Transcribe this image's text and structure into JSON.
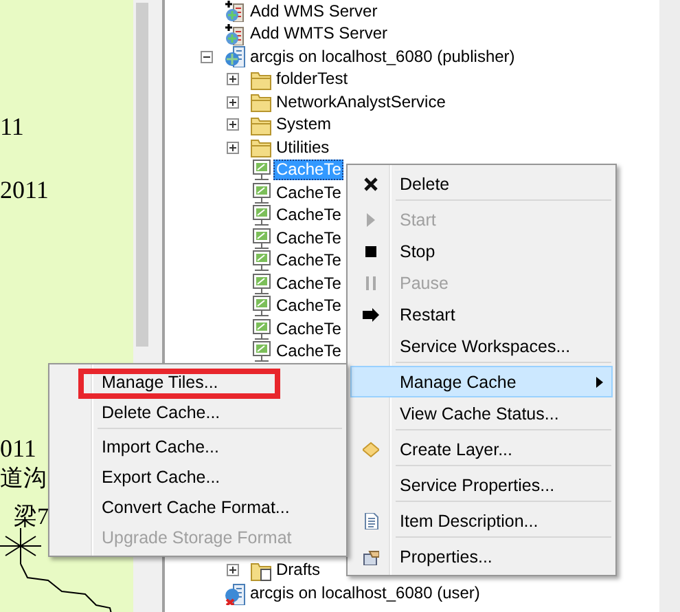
{
  "map": {
    "labels": [
      {
        "text": "11"
      },
      {
        "text": "2011"
      },
      {
        "text": "011"
      },
      {
        "text": "道沟"
      },
      {
        "text": "梁7"
      }
    ]
  },
  "tree": {
    "top": [
      {
        "children": [
          {
            "label": "Add WMS Server",
            "kind": "add"
          },
          {
            "label": "Add WMTS Server",
            "kind": "add"
          },
          {
            "label": "arcgis on localhost_6080 (publisher)",
            "kind": "server",
            "expanded": true,
            "children": [
              {
                "label": "folderTest",
                "kind": "folder",
                "expanded": false
              },
              {
                "label": "NetworkAnalystService",
                "kind": "folder",
                "expanded": false
              },
              {
                "label": "System",
                "kind": "folder",
                "expanded": false
              },
              {
                "label": "Utilities",
                "kind": "folder",
                "expanded": false
              },
              {
                "label": "CacheTe",
                "kind": "service",
                "selected": true
              },
              {
                "label": "CacheTe",
                "kind": "service",
                "selected": false
              },
              {
                "label": "CacheTe",
                "kind": "service",
                "selected": false
              },
              {
                "label": "CacheTe",
                "kind": "service",
                "selected": false
              },
              {
                "label": "CacheTe",
                "kind": "service",
                "selected": false
              },
              {
                "label": "CacheTe",
                "kind": "service",
                "selected": false
              },
              {
                "label": "CacheTe",
                "kind": "service",
                "selected": false
              },
              {
                "label": "CacheTe",
                "kind": "service",
                "selected": false
              },
              {
                "label": "CacheTe",
                "kind": "service",
                "selected": false
              }
            ]
          }
        ]
      }
    ],
    "bottom": [
      {
        "children": [
          {
            "children": [
              {
                "label": "Drafts",
                "kind": "drafts",
                "expanded": false
              }
            ]
          },
          {
            "label": "arcgis on localhost_6080 (user)",
            "kind": "offline"
          }
        ]
      }
    ]
  },
  "context_menu": {
    "items": [
      {
        "label": "Delete",
        "kind": "delete",
        "disabled": false,
        "separator_after": true,
        "highlighted": false
      },
      {
        "label": "Start",
        "kind": "start",
        "disabled": true,
        "separator_after": false,
        "highlighted": false
      },
      {
        "label": "Stop",
        "kind": "stop",
        "disabled": false,
        "separator_after": false,
        "highlighted": false
      },
      {
        "label": "Pause",
        "kind": "pause",
        "disabled": true,
        "separator_after": false,
        "highlighted": false
      },
      {
        "label": "Restart",
        "kind": "restart",
        "disabled": false,
        "separator_after": false,
        "highlighted": false
      },
      {
        "label": "Service Workspaces...",
        "kind": "plain",
        "disabled": false,
        "separator_after": true,
        "highlighted": false
      },
      {
        "label": "Manage Cache",
        "kind": "submenu",
        "disabled": false,
        "separator_after": false,
        "highlighted": true
      },
      {
        "label": "View Cache Status...",
        "kind": "plain",
        "disabled": false,
        "separator_after": true,
        "highlighted": false
      },
      {
        "label": "Create Layer...",
        "kind": "layer",
        "disabled": false,
        "separator_after": true,
        "highlighted": false
      },
      {
        "label": "Service Properties...",
        "kind": "plain",
        "disabled": false,
        "separator_after": true,
        "highlighted": false
      },
      {
        "label": "Item Description...",
        "kind": "description",
        "disabled": false,
        "separator_after": true,
        "highlighted": false
      },
      {
        "label": "Properties...",
        "kind": "properties",
        "disabled": false,
        "separator_after": false,
        "highlighted": false
      }
    ]
  },
  "submenu": {
    "items": [
      {
        "label": "Manage Tiles...",
        "disabled": false,
        "separator_after": false,
        "annotated": true
      },
      {
        "label": "Delete Cache...",
        "disabled": false,
        "separator_after": true,
        "annotated": false
      },
      {
        "label": "Import Cache...",
        "disabled": false,
        "separator_after": false,
        "annotated": false
      },
      {
        "label": "Export Cache...",
        "disabled": false,
        "separator_after": false,
        "annotated": false
      },
      {
        "label": "Convert Cache Format...",
        "disabled": false,
        "separator_after": false,
        "annotated": false
      },
      {
        "label": "Upgrade Storage Format",
        "disabled": true,
        "separator_after": false,
        "annotated": false
      }
    ]
  }
}
